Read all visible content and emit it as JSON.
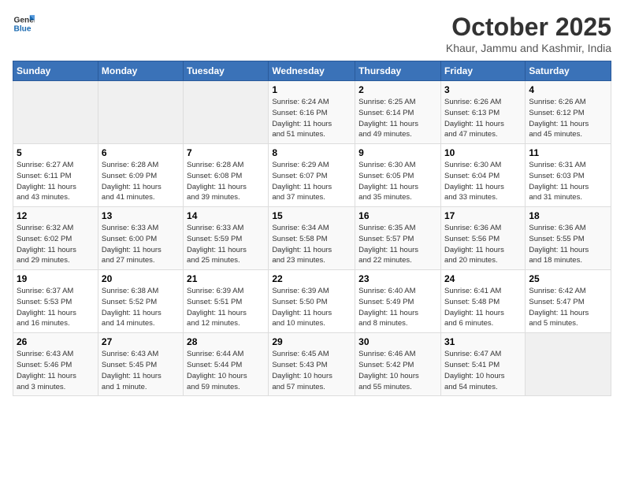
{
  "logo": {
    "line1": "General",
    "line2": "Blue"
  },
  "title": "October 2025",
  "subtitle": "Khaur, Jammu and Kashmir, India",
  "days_of_week": [
    "Sunday",
    "Monday",
    "Tuesday",
    "Wednesday",
    "Thursday",
    "Friday",
    "Saturday"
  ],
  "weeks": [
    [
      {
        "day": "",
        "info": ""
      },
      {
        "day": "",
        "info": ""
      },
      {
        "day": "",
        "info": ""
      },
      {
        "day": "1",
        "info": "Sunrise: 6:24 AM\nSunset: 6:16 PM\nDaylight: 11 hours\nand 51 minutes."
      },
      {
        "day": "2",
        "info": "Sunrise: 6:25 AM\nSunset: 6:14 PM\nDaylight: 11 hours\nand 49 minutes."
      },
      {
        "day": "3",
        "info": "Sunrise: 6:26 AM\nSunset: 6:13 PM\nDaylight: 11 hours\nand 47 minutes."
      },
      {
        "day": "4",
        "info": "Sunrise: 6:26 AM\nSunset: 6:12 PM\nDaylight: 11 hours\nand 45 minutes."
      }
    ],
    [
      {
        "day": "5",
        "info": "Sunrise: 6:27 AM\nSunset: 6:11 PM\nDaylight: 11 hours\nand 43 minutes."
      },
      {
        "day": "6",
        "info": "Sunrise: 6:28 AM\nSunset: 6:09 PM\nDaylight: 11 hours\nand 41 minutes."
      },
      {
        "day": "7",
        "info": "Sunrise: 6:28 AM\nSunset: 6:08 PM\nDaylight: 11 hours\nand 39 minutes."
      },
      {
        "day": "8",
        "info": "Sunrise: 6:29 AM\nSunset: 6:07 PM\nDaylight: 11 hours\nand 37 minutes."
      },
      {
        "day": "9",
        "info": "Sunrise: 6:30 AM\nSunset: 6:05 PM\nDaylight: 11 hours\nand 35 minutes."
      },
      {
        "day": "10",
        "info": "Sunrise: 6:30 AM\nSunset: 6:04 PM\nDaylight: 11 hours\nand 33 minutes."
      },
      {
        "day": "11",
        "info": "Sunrise: 6:31 AM\nSunset: 6:03 PM\nDaylight: 11 hours\nand 31 minutes."
      }
    ],
    [
      {
        "day": "12",
        "info": "Sunrise: 6:32 AM\nSunset: 6:02 PM\nDaylight: 11 hours\nand 29 minutes."
      },
      {
        "day": "13",
        "info": "Sunrise: 6:33 AM\nSunset: 6:00 PM\nDaylight: 11 hours\nand 27 minutes."
      },
      {
        "day": "14",
        "info": "Sunrise: 6:33 AM\nSunset: 5:59 PM\nDaylight: 11 hours\nand 25 minutes."
      },
      {
        "day": "15",
        "info": "Sunrise: 6:34 AM\nSunset: 5:58 PM\nDaylight: 11 hours\nand 23 minutes."
      },
      {
        "day": "16",
        "info": "Sunrise: 6:35 AM\nSunset: 5:57 PM\nDaylight: 11 hours\nand 22 minutes."
      },
      {
        "day": "17",
        "info": "Sunrise: 6:36 AM\nSunset: 5:56 PM\nDaylight: 11 hours\nand 20 minutes."
      },
      {
        "day": "18",
        "info": "Sunrise: 6:36 AM\nSunset: 5:55 PM\nDaylight: 11 hours\nand 18 minutes."
      }
    ],
    [
      {
        "day": "19",
        "info": "Sunrise: 6:37 AM\nSunset: 5:53 PM\nDaylight: 11 hours\nand 16 minutes."
      },
      {
        "day": "20",
        "info": "Sunrise: 6:38 AM\nSunset: 5:52 PM\nDaylight: 11 hours\nand 14 minutes."
      },
      {
        "day": "21",
        "info": "Sunrise: 6:39 AM\nSunset: 5:51 PM\nDaylight: 11 hours\nand 12 minutes."
      },
      {
        "day": "22",
        "info": "Sunrise: 6:39 AM\nSunset: 5:50 PM\nDaylight: 11 hours\nand 10 minutes."
      },
      {
        "day": "23",
        "info": "Sunrise: 6:40 AM\nSunset: 5:49 PM\nDaylight: 11 hours\nand 8 minutes."
      },
      {
        "day": "24",
        "info": "Sunrise: 6:41 AM\nSunset: 5:48 PM\nDaylight: 11 hours\nand 6 minutes."
      },
      {
        "day": "25",
        "info": "Sunrise: 6:42 AM\nSunset: 5:47 PM\nDaylight: 11 hours\nand 5 minutes."
      }
    ],
    [
      {
        "day": "26",
        "info": "Sunrise: 6:43 AM\nSunset: 5:46 PM\nDaylight: 11 hours\nand 3 minutes."
      },
      {
        "day": "27",
        "info": "Sunrise: 6:43 AM\nSunset: 5:45 PM\nDaylight: 11 hours\nand 1 minute."
      },
      {
        "day": "28",
        "info": "Sunrise: 6:44 AM\nSunset: 5:44 PM\nDaylight: 10 hours\nand 59 minutes."
      },
      {
        "day": "29",
        "info": "Sunrise: 6:45 AM\nSunset: 5:43 PM\nDaylight: 10 hours\nand 57 minutes."
      },
      {
        "day": "30",
        "info": "Sunrise: 6:46 AM\nSunset: 5:42 PM\nDaylight: 10 hours\nand 55 minutes."
      },
      {
        "day": "31",
        "info": "Sunrise: 6:47 AM\nSunset: 5:41 PM\nDaylight: 10 hours\nand 54 minutes."
      },
      {
        "day": "",
        "info": ""
      }
    ]
  ]
}
